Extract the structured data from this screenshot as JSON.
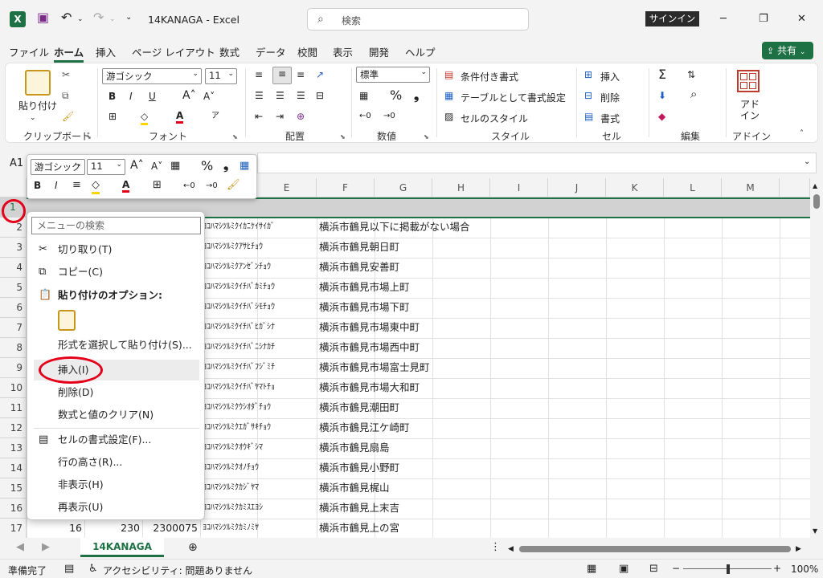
{
  "title_bar": {
    "doc_title": "14KANAGA  -  Excel",
    "search_placeholder": "検索",
    "signin": "サインイン"
  },
  "menu": [
    "ファイル",
    "ホーム",
    "挿入",
    "ページ レイアウト",
    "数式",
    "データ",
    "校閲",
    "表示",
    "開発",
    "ヘルプ"
  ],
  "share_label": "共有",
  "ribbon": {
    "clipboard": {
      "paste": "貼り付け",
      "label": "クリップボード"
    },
    "font": {
      "name": "游ゴシック",
      "size": "11",
      "label": "フォント"
    },
    "align": {
      "label": "配置"
    },
    "number": {
      "format": "標準",
      "label": "数値"
    },
    "styles": {
      "conditional": "条件付き書式",
      "table": "テーブルとして書式設定",
      "cell_style": "セルのスタイル",
      "label": "スタイル"
    },
    "cells": {
      "insert": "挿入",
      "delete": "削除",
      "format": "書式",
      "label": "セル"
    },
    "editing": {
      "label": "編集"
    },
    "addins": {
      "btn1": "アド",
      "btn2": "イン",
      "label": "アドイン"
    }
  },
  "name_box": "A1",
  "mini_toolbar": {
    "font": "游ゴシック",
    "size": "11"
  },
  "columns": [
    "E",
    "F",
    "G",
    "H",
    "I",
    "J",
    "K",
    "L",
    "M"
  ],
  "rows": [
    {
      "n": "1",
      "a": "",
      "b": "",
      "c": "",
      "d": "",
      "e": ""
    },
    {
      "n": "2",
      "a": "",
      "b": "",
      "c": "",
      "d": "ﾖｺﾊﾏｼﾂﾙﾐｸｲｶﾆｹｲｻｲｶﾞ",
      "e": "横浜市鶴見以下に掲載がない場合"
    },
    {
      "n": "3",
      "a": "",
      "b": "",
      "c": "",
      "d": "ﾖｺﾊﾏｼﾂﾙﾐｸｱｻﾋﾁｮｳ",
      "e": "横浜市鶴見朝日町"
    },
    {
      "n": "4",
      "a": "",
      "b": "",
      "c": "",
      "d": "ﾖｺﾊﾏｼﾂﾙﾐｸｱﾝｾﾞﾝﾁｮｳ",
      "e": "横浜市鶴見安善町"
    },
    {
      "n": "5",
      "a": "",
      "b": "",
      "c": "",
      "d": "ﾖｺﾊﾏｼﾂﾙﾐｸｲﾁﾊﾞｶﾐﾁｮｳ",
      "e": "横浜市鶴見市場上町"
    },
    {
      "n": "6",
      "a": "",
      "b": "",
      "c": "",
      "d": "ﾖｺﾊﾏｼﾂﾙﾐｸｲﾁﾊﾞｼﾓﾁｮｳ",
      "e": "横浜市鶴見市場下町"
    },
    {
      "n": "7",
      "a": "",
      "b": "",
      "c": "",
      "d": "ﾖｺﾊﾏｼﾂﾙﾐｸｲﾁﾊﾞﾋｶﾞｼﾅ",
      "e": "横浜市鶴見市場東中町"
    },
    {
      "n": "8",
      "a": "",
      "b": "",
      "c": "",
      "d": "ﾖｺﾊﾏｼﾂﾙﾐｸｲﾁﾊﾞﾆｼﾅｶﾁ",
      "e": "横浜市鶴見市場西中町"
    },
    {
      "n": "9",
      "a": "",
      "b": "",
      "c": "",
      "d": "ﾖｺﾊﾏｼﾂﾙﾐｸｲﾁﾊﾞﾌｼﾞﾐﾁ",
      "e": "横浜市鶴見市場富士見町"
    },
    {
      "n": "10",
      "a": "",
      "b": "",
      "c": "",
      "d": "ﾖｺﾊﾏｼﾂﾙﾐｸｲﾁﾊﾞﾔﾏﾄﾁｮ",
      "e": "横浜市鶴見市場大和町"
    },
    {
      "n": "11",
      "a": "",
      "b": "",
      "c": "",
      "d": "ﾖｺﾊﾏｼﾂﾙﾐｸｳｼｵﾀﾞﾁｮｳ",
      "e": "横浜市鶴見潮田町"
    },
    {
      "n": "12",
      "a": "",
      "b": "",
      "c": "",
      "d": "ﾖｺﾊﾏｼﾂﾙﾐｸｴｶﾞｻｷﾁｮｳ",
      "e": "横浜市鶴見江ケ崎町"
    },
    {
      "n": "13",
      "a": "",
      "b": "",
      "c": "",
      "d": "ﾖｺﾊﾏｼﾂﾙﾐｸｵｳｷﾞｼﾏ",
      "e": "横浜市鶴見扇島"
    },
    {
      "n": "14",
      "a": "",
      "b": "",
      "c": "",
      "d": "ﾖｺﾊﾏｼﾂﾙﾐｸｵﾉﾁｮｳ",
      "e": "横浜市鶴見小野町"
    },
    {
      "n": "15",
      "a": "",
      "b": "",
      "c": "",
      "d": "ﾖｺﾊﾏｼﾂﾙﾐｸｶｼﾞﾔﾏ",
      "e": "横浜市鶴見梶山"
    },
    {
      "n": "16",
      "a": "",
      "b": "",
      "c": "",
      "d": "ﾖｺﾊﾏｼﾂﾙﾐｸｶﾐｽｴﾖｼ",
      "e": "横浜市鶴見上末吉"
    },
    {
      "n": "17",
      "a": "16",
      "b": "230",
      "c": "2300075",
      "d": "ﾖｺﾊﾏｼﾂﾙﾐｸｶﾐﾉﾐﾔ",
      "e": "横浜市鶴見上の宮"
    }
  ],
  "context_menu": {
    "search_placeholder": "メニューの検索",
    "cut": "切り取り(T)",
    "copy": "コピー(C)",
    "paste_options": "貼り付けのオプション:",
    "paste_special": "形式を選択して貼り付け(S)...",
    "insert": "挿入(I)",
    "delete": "削除(D)",
    "clear": "数式と値のクリア(N)",
    "format_cells": "セルの書式設定(F)...",
    "row_height": "行の高さ(R)...",
    "hide": "非表示(H)",
    "unhide": "再表示(U)"
  },
  "sheet_tab": "14KANAGA",
  "status": {
    "ready": "準備完了",
    "accessibility": "アクセシビリティ: 問題ありません",
    "zoom": "100%"
  },
  "colors": {
    "excel_green": "#1e7145",
    "highlight_red": "#e3001b"
  }
}
